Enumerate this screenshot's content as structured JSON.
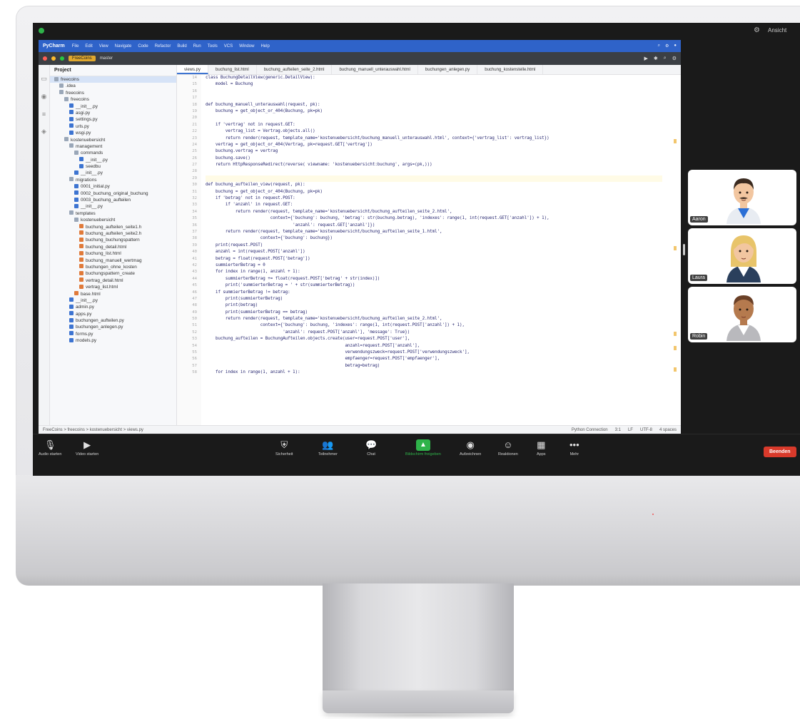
{
  "meeting": {
    "view_label": "Ansicht",
    "end_button": "Beenden"
  },
  "ide": {
    "app_title": "PyCharm",
    "menu": [
      "File",
      "Edit",
      "View",
      "Navigate",
      "Code",
      "Refactor",
      "Build",
      "Run",
      "Tools",
      "VCS",
      "Window",
      "Help"
    ],
    "project_name": "FreeCoins",
    "branch": "master",
    "project_header": "Project",
    "tabs": [
      "views.py",
      "buchung_list.html",
      "buchung_aufteilen_seite_2.html",
      "buchung_manuell_unterauswahl.html",
      "buchungen_anlegen.py",
      "buchung_kostenstelle.html"
    ],
    "status_left": "FreeCoins > freecoins > kostenuebersicht > views.py",
    "status_right": [
      "Python Connection",
      "3:1",
      "LF",
      "UTF-8",
      "4 spaces"
    ],
    "tree": [
      {
        "label": "freecoins",
        "depth": 0,
        "type": "folder"
      },
      {
        "label": ".idea",
        "depth": 1,
        "type": "folder"
      },
      {
        "label": "freecoins",
        "depth": 1,
        "type": "folder"
      },
      {
        "label": "freecoins",
        "depth": 2,
        "type": "folder"
      },
      {
        "label": "__init__.py",
        "depth": 3,
        "type": "py"
      },
      {
        "label": "asgi.py",
        "depth": 3,
        "type": "py"
      },
      {
        "label": "settings.py",
        "depth": 3,
        "type": "py"
      },
      {
        "label": "urls.py",
        "depth": 3,
        "type": "py"
      },
      {
        "label": "wsgi.py",
        "depth": 3,
        "type": "py"
      },
      {
        "label": "kostenuebersicht",
        "depth": 2,
        "type": "folder"
      },
      {
        "label": "management",
        "depth": 3,
        "type": "folder"
      },
      {
        "label": "commands",
        "depth": 4,
        "type": "folder"
      },
      {
        "label": "__init__.py",
        "depth": 5,
        "type": "py"
      },
      {
        "label": "seedbu",
        "depth": 5,
        "type": "py"
      },
      {
        "label": "__init__.py",
        "depth": 4,
        "type": "py"
      },
      {
        "label": "migrations",
        "depth": 3,
        "type": "folder"
      },
      {
        "label": "0001_initial.py",
        "depth": 4,
        "type": "py"
      },
      {
        "label": "0002_buchung_original_buchung",
        "depth": 4,
        "type": "py"
      },
      {
        "label": "0003_buchung_aufteilen",
        "depth": 4,
        "type": "py"
      },
      {
        "label": "__init__.py",
        "depth": 4,
        "type": "py"
      },
      {
        "label": "templates",
        "depth": 3,
        "type": "folder"
      },
      {
        "label": "kostenuebersicht",
        "depth": 4,
        "type": "folder"
      },
      {
        "label": "buchung_aufteilen_seite1.h",
        "depth": 5,
        "type": "html"
      },
      {
        "label": "buchung_aufteilen_seite2.h",
        "depth": 5,
        "type": "html"
      },
      {
        "label": "buchung_buchungspattern",
        "depth": 5,
        "type": "html"
      },
      {
        "label": "buchung_detail.html",
        "depth": 5,
        "type": "html"
      },
      {
        "label": "buchung_list.html",
        "depth": 5,
        "type": "html"
      },
      {
        "label": "buchung_manuell_wertmag",
        "depth": 5,
        "type": "html"
      },
      {
        "label": "buchungen_ohne_kosten",
        "depth": 5,
        "type": "html"
      },
      {
        "label": "buchungspattern_create",
        "depth": 5,
        "type": "html"
      },
      {
        "label": "vertrag_detail.html",
        "depth": 5,
        "type": "html"
      },
      {
        "label": "vertrag_list.html",
        "depth": 5,
        "type": "html"
      },
      {
        "label": "base.html",
        "depth": 4,
        "type": "html"
      },
      {
        "label": "__init__.py",
        "depth": 3,
        "type": "py"
      },
      {
        "label": "admin.py",
        "depth": 3,
        "type": "py"
      },
      {
        "label": "apps.py",
        "depth": 3,
        "type": "py"
      },
      {
        "label": "buchungen_aufteilen.py",
        "depth": 3,
        "type": "py"
      },
      {
        "label": "buchungen_anlegen.py",
        "depth": 3,
        "type": "py"
      },
      {
        "label": "forms.py",
        "depth": 3,
        "type": "py"
      },
      {
        "label": "models.py",
        "depth": 3,
        "type": "py"
      }
    ],
    "code_start_line": 14,
    "code_lines": [
      "class BuchungDetailView(generic.DetailView):",
      "    model = Buchung",
      "",
      "",
      "def buchung_manuell_unterauswahl(request, pk):",
      "    buchung = get_object_or_404(Buchung, pk=pk)",
      "",
      "    if 'vertrag' not in request.GET:",
      "        vertrag_list = Vertrag.objects.all()",
      "        return render(request, template_name='kostenuebersicht/buchung_manuell_unterauswahl.html', context={'vertrag_list': vertrag_list})",
      "    vertrag = get_object_or_404(Vertrag, pk=request.GET['vertrag'])",
      "    buchung.vertrag = vertrag",
      "    buchung.save()",
      "    return HttpResponseRedirect(reverse( viewname: 'kostenuebersicht:buchung', args=(pk,)))",
      "",
      "",
      "def buchung_aufteilen_view(request, pk):",
      "    buchung = get_object_or_404(Buchung, pk=pk)",
      "    if 'betrag' not in request.POST:",
      "        if 'anzahl' in request.GET:",
      "            return render(request, template_name='kostenuebersicht/buchung_aufteilen_seite_2.html',",
      "                          context={'buchung': buchung, 'betrag': str(buchung.betrag), 'indexes': range(1, int(request.GET['anzahl']) + 1),",
      "                                   'anzahl': request.GET['anzahl']})",
      "        return render(request, template_name='kostenuebersicht/buchung_aufteilen_seite_1.html',",
      "                      context={'buchung': buchung})",
      "    print(request.POST)",
      "    anzahl = int(request.POST['anzahl'])",
      "    betrag = float(request.POST['betrag'])",
      "    summierterBetrag = 0",
      "    for index in range(1, anzahl + 1):",
      "        summierterBetrag += float(request.POST['betrag' + str(index)])",
      "        print('summierterBetrag = ' + str(summierterBetrag))",
      "    if summierterBetrag != betrag:",
      "        print(summierterBetrag)",
      "        print(betrag)",
      "        print(summierterBetrag == betrag)",
      "        return render(request, template_name='kostenuebersicht/buchung_aufteilen_seite_2.html',",
      "                      context={'buchung': buchung, 'indexes': range(1, int(request.POST['anzahl']) + 1),",
      "                               'anzahl': request.POST['anzahl'], 'message': True})",
      "    buchung_aufteilen = BuchungAufteilen.objects.create(user=request.POST['user'],",
      "                                                        anzahl=request.POST['anzahl'],",
      "                                                        verwendungszweck=request.POST['verwendungszweck'],",
      "                                                        empfaenger=request.POST['empfaenger'],",
      "                                                        betrag=betrag)",
      "    for index in range(1, anzahl + 1):"
    ]
  },
  "participants": [
    {
      "name": "Aaron",
      "skin": "#f2c6a0",
      "hair": "#3a2a1f",
      "shirt": "#2b6fd6",
      "suit": "#e8ecf2"
    },
    {
      "name": "Laura",
      "skin": "#f2c6a0",
      "hair": "#e8c46a",
      "shirt": "#ffffff",
      "suit": "#2a3f5c"
    },
    {
      "name": "Robin",
      "skin": "#b57a4e",
      "hair": "#6a4027",
      "shirt": "#ffffff",
      "suit": "#b9b9bd"
    }
  ],
  "controls": [
    {
      "name": "mute",
      "label": "Audio starten",
      "icon": "microphone-icon"
    },
    {
      "name": "video",
      "label": "Video starten",
      "icon": "camera-icon"
    },
    {
      "name": "security",
      "label": "Sicherheit",
      "icon": "shield-icon"
    },
    {
      "name": "participants",
      "label": "Teilnehmer",
      "icon": "people-icon",
      "count": "3"
    },
    {
      "name": "chat",
      "label": "Chat",
      "icon": "chat-icon"
    },
    {
      "name": "share",
      "label": "Bildschirm freigeben",
      "icon": "share-screen-icon"
    },
    {
      "name": "record",
      "label": "Aufzeichnen",
      "icon": "record-icon"
    },
    {
      "name": "reactions",
      "label": "Reaktionen",
      "icon": "smile-icon"
    },
    {
      "name": "apps",
      "label": "Apps",
      "icon": "apps-icon"
    },
    {
      "name": "more",
      "label": "Mehr",
      "icon": "more-icon"
    }
  ]
}
